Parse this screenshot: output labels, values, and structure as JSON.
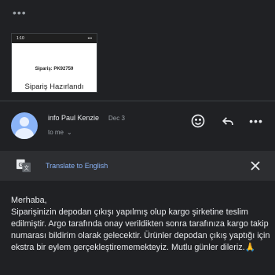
{
  "header": {
    "overflow_icon": "more-horiz-icon"
  },
  "attachment": {
    "status_time": "1:10",
    "order_label": "Sipariş: PK92759",
    "title": "Sipariş Hazırlandı"
  },
  "email": {
    "sender": "info Paul Kenzie",
    "date": "Dec 3",
    "recipient": "to me",
    "actions": [
      "emoji-icon",
      "reply-icon",
      "more-vert-icon"
    ]
  },
  "translate": {
    "label": "Translate to English",
    "icon": "translate-icon",
    "close_icon": "close-icon"
  },
  "message": {
    "greeting": "Merhaba,",
    "body": "Siparişinizin depodan çıkışı yapılmış olup kargo şirketine teslim edilmiştir. Argo tarafında onay verildikten sonra tarafınıza kargo takip numarası bildirim olarak gelecektir. Ürünler depodan çıkış yaptığı için ekstra bir eylem gerçekleştirememekteyiz. Mutlu günler dileriz.🙏"
  },
  "colors": {
    "background": "#202124",
    "banner": "#2d2e31",
    "link": "#8ab4f8",
    "text": "#e8eaed",
    "muted": "#9aa0a6"
  }
}
